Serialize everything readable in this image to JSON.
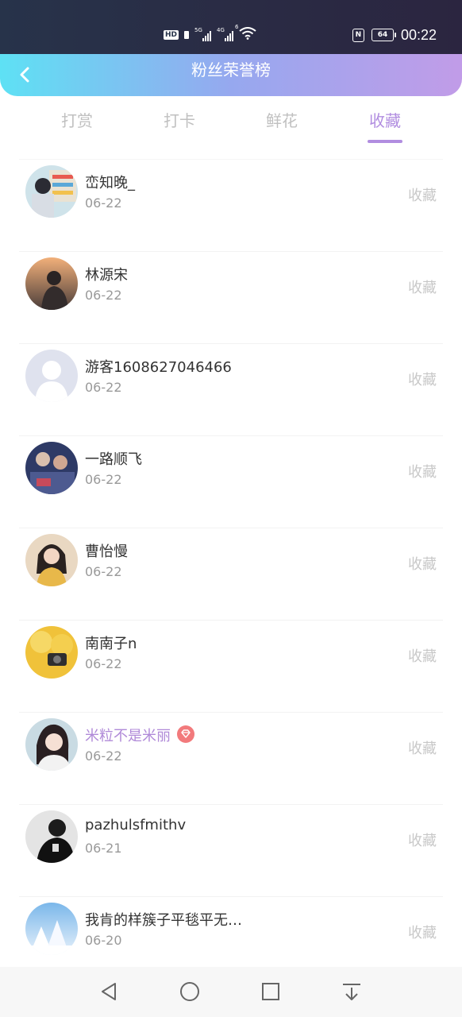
{
  "status_bar": {
    "hd_label": "HD",
    "sim1_label": "5G",
    "sim2_label": "4G",
    "wifi_label": "6",
    "nfc_label": "N",
    "battery_level": "64",
    "time": "00:22"
  },
  "header": {
    "title": "粉丝荣誉榜",
    "back_icon": "chevron-left-icon"
  },
  "tabs": [
    {
      "label": "打赏",
      "active": false
    },
    {
      "label": "打卡",
      "active": false
    },
    {
      "label": "鲜花",
      "active": false
    },
    {
      "label": "收藏",
      "active": true
    }
  ],
  "fans": [
    {
      "name": "峦知晚_",
      "date": "06-22",
      "action": "收藏",
      "vip": false
    },
    {
      "name": "林源宋",
      "date": "06-22",
      "action": "收藏",
      "vip": false
    },
    {
      "name": "游客1608627046466",
      "date": "06-22",
      "action": "收藏",
      "vip": false
    },
    {
      "name": "一路顺飞",
      "date": "06-22",
      "action": "收藏",
      "vip": false
    },
    {
      "name": "曹怡慢",
      "date": "06-22",
      "action": "收藏",
      "vip": false
    },
    {
      "name": "南南子n",
      "date": "06-22",
      "action": "收藏",
      "vip": false
    },
    {
      "name": "米粒不是米丽",
      "date": "06-22",
      "action": "收藏",
      "vip": true
    },
    {
      "name": "pazhulsfmithv",
      "date": "06-21",
      "action": "收藏",
      "vip": false
    },
    {
      "name": "我肯的样簇子平毯平无…",
      "date": "06-20",
      "action": "收藏",
      "vip": false
    }
  ],
  "colors": {
    "accent": "#b18de0",
    "header_gradient_start": "#5ee1f4",
    "header_gradient_end": "#c19ce8",
    "vip_badge": "#f27a7c"
  },
  "nav_bar": {
    "icons": [
      "back-triangle-icon",
      "home-circle-icon",
      "recents-square-icon",
      "notification-pull-down-icon"
    ]
  }
}
